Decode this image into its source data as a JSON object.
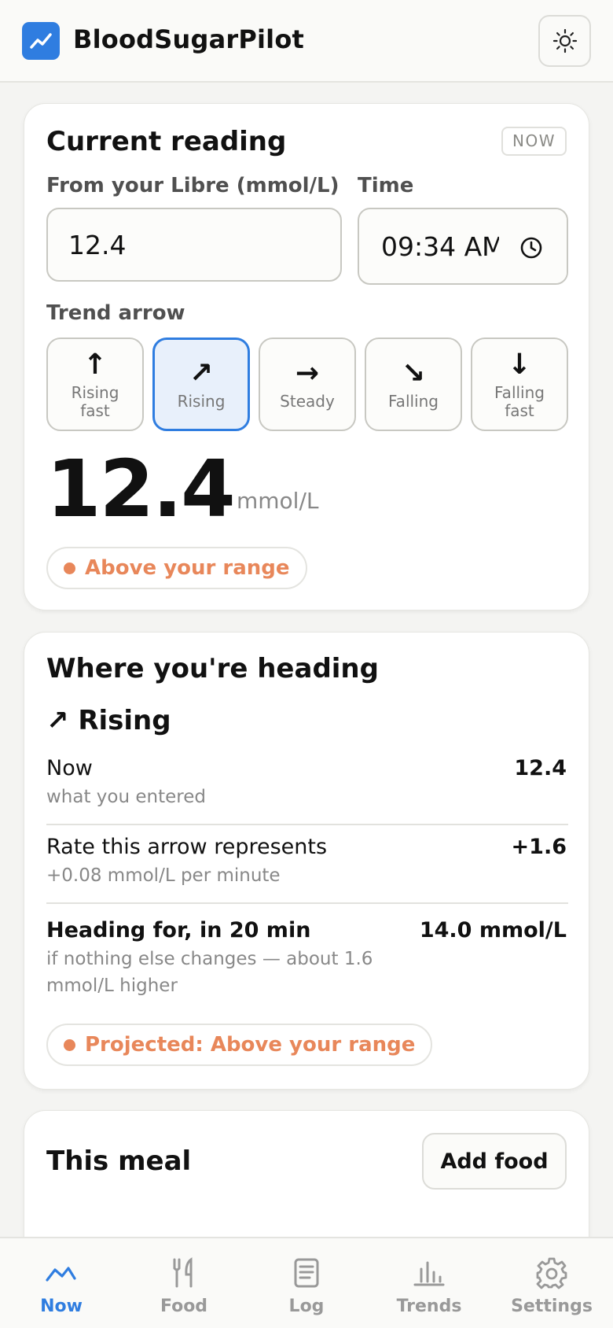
{
  "app": {
    "title": "BloodSugarPilot"
  },
  "current": {
    "title": "Current reading",
    "badge": "NOW",
    "reading_label": "From your Libre (mmol/L)",
    "reading_value": "12.4",
    "time_label": "Time",
    "time_value": "09:34 AM",
    "trend_label": "Trend arrow",
    "trends": [
      {
        "arrow": "↑",
        "label": "Rising fast",
        "selected": false
      },
      {
        "arrow": "↗",
        "label": "Rising",
        "selected": true
      },
      {
        "arrow": "→",
        "label": "Steady",
        "selected": false
      },
      {
        "arrow": "↘",
        "label": "Falling",
        "selected": false
      },
      {
        "arrow": "↓",
        "label": "Falling fast",
        "selected": false
      }
    ],
    "display_value": "12.4",
    "display_unit": "mmol/L",
    "status": "Above your range"
  },
  "heading": {
    "title": "Where you're heading",
    "direction": "↗ Rising",
    "rows": [
      {
        "main": "Now",
        "sub": "what you entered",
        "value": "12.4"
      },
      {
        "main": "Rate this arrow represents",
        "sub": "+0.08 mmol/L per minute",
        "value": "+1.6"
      },
      {
        "main": "Heading for, in 20 min",
        "sub": "if nothing else changes — about 1.6 mmol/L higher",
        "value": "14.0 mmol/L"
      }
    ],
    "projected_status": "Projected: Above your range"
  },
  "meal": {
    "title": "This meal",
    "add_label": "Add food"
  },
  "nav": [
    {
      "label": "Now",
      "icon": "trend-line-icon",
      "active": true
    },
    {
      "label": "Food",
      "icon": "fork-knife-icon",
      "active": false
    },
    {
      "label": "Log",
      "icon": "document-icon",
      "active": false
    },
    {
      "label": "Trends",
      "icon": "bar-chart-icon",
      "active": false
    },
    {
      "label": "Settings",
      "icon": "gear-icon",
      "active": false
    }
  ],
  "colors": {
    "accent": "#2f7de0",
    "warning": "#e8875a"
  }
}
